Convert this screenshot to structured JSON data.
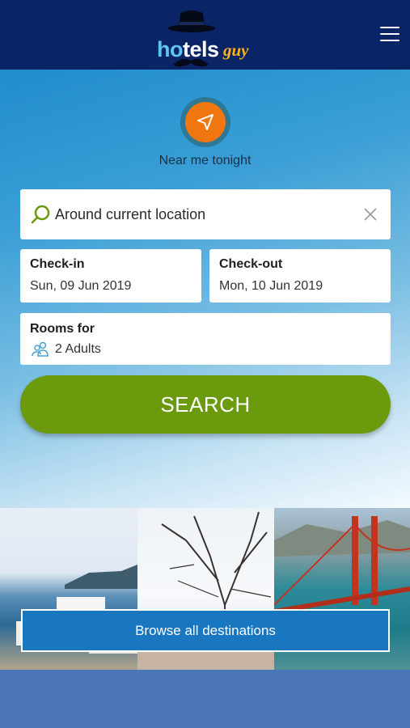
{
  "header": {
    "logo_hotels": "hotels",
    "logo_guy": "guy",
    "menu_icon": "hamburger-menu-icon"
  },
  "near_me": {
    "icon": "location-arrow-icon",
    "label": "Near me tonight"
  },
  "search": {
    "icon": "search-icon",
    "value": "Around current location",
    "clear_icon": "close-icon"
  },
  "checkin": {
    "label": "Check-in",
    "value": "Sun, 09 Jun 2019"
  },
  "checkout": {
    "label": "Check-out",
    "value": "Mon, 10 Jun 2019"
  },
  "rooms": {
    "label": "Rooms for",
    "icon": "people-icon",
    "value": "2 Adults"
  },
  "search_button": {
    "label": "SEARCH"
  },
  "browse_button": {
    "label": "Browse all destinations"
  },
  "colors": {
    "header_bg": "#0b2466",
    "accent_orange": "#f0760f",
    "search_green": "#6b9a0c",
    "browse_blue": "#1976c0"
  }
}
